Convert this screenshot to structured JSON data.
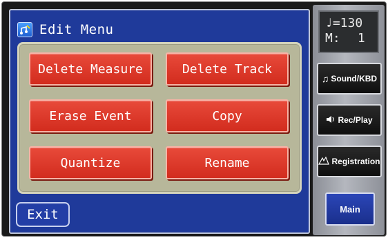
{
  "screen": {
    "title": "Edit Menu",
    "title_icon": "edit-music-icon",
    "buttons": [
      {
        "label": "Delete Measure"
      },
      {
        "label": "Delete Track"
      },
      {
        "label": "Erase Event"
      },
      {
        "label": "Copy"
      },
      {
        "label": "Quantize"
      },
      {
        "label": "Rename"
      }
    ],
    "exit_label": "Exit"
  },
  "side": {
    "tempo_note": "♩",
    "tempo_eq": "=130",
    "measure_label": "M:",
    "measure_value": "1",
    "buttons": [
      {
        "label": "Sound/KBD",
        "icon": "music-note-icon"
      },
      {
        "label": "Rec/Play",
        "icon": "speaker-icon"
      },
      {
        "label": "Registration",
        "icon": "registration-icon"
      }
    ],
    "main_label": "Main"
  },
  "colors": {
    "screen_bg": "#1f3a9a",
    "panel_bg": "#b7b79a",
    "button_red": "#d22c1e"
  }
}
